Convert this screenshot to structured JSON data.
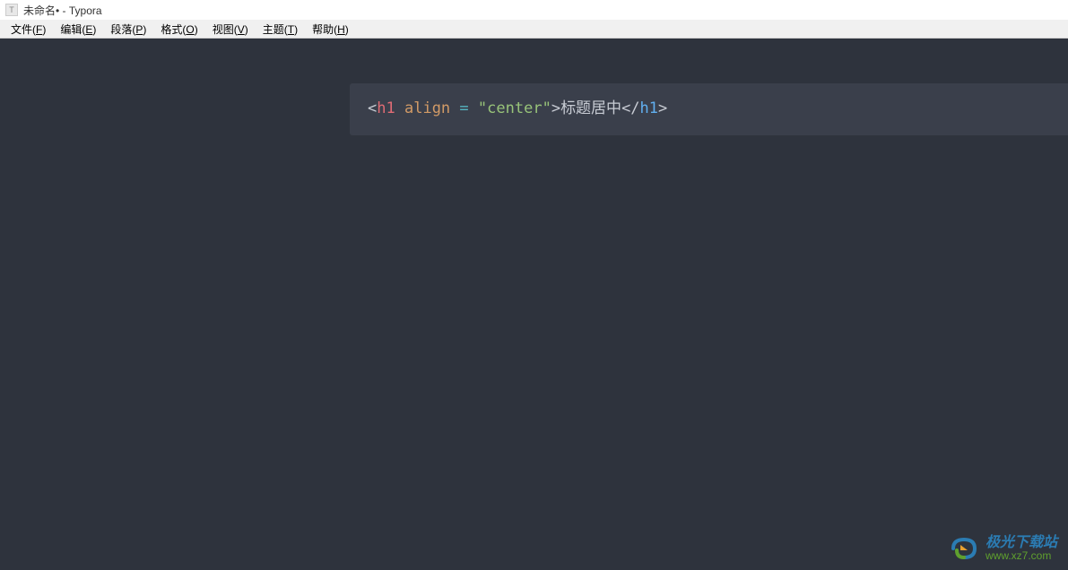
{
  "titlebar": {
    "icon_letter": "T",
    "title": "未命名• - Typora"
  },
  "menubar": {
    "items": [
      {
        "label": "文件(",
        "hotkey": "F",
        "suffix": ")"
      },
      {
        "label": "编辑(",
        "hotkey": "E",
        "suffix": ")"
      },
      {
        "label": "段落(",
        "hotkey": "P",
        "suffix": ")"
      },
      {
        "label": "格式(",
        "hotkey": "O",
        "suffix": ")"
      },
      {
        "label": "视图(",
        "hotkey": "V",
        "suffix": ")"
      },
      {
        "label": "主题(",
        "hotkey": "T",
        "suffix": ")"
      },
      {
        "label": "帮助(",
        "hotkey": "H",
        "suffix": ")"
      }
    ]
  },
  "editor": {
    "code": {
      "open_bracket": "<",
      "tag_open": "h1",
      "space1": " ",
      "attr_name": "align",
      "space2": " ",
      "equals": "=",
      "space3": " ",
      "attr_value": "\"center\"",
      "close_bracket": ">",
      "text": "标题居中",
      "close_open": "</",
      "tag_close": "h1",
      "close_close": ">"
    }
  },
  "watermark": {
    "name": "极光下载站",
    "url": "www.xz7.com"
  }
}
